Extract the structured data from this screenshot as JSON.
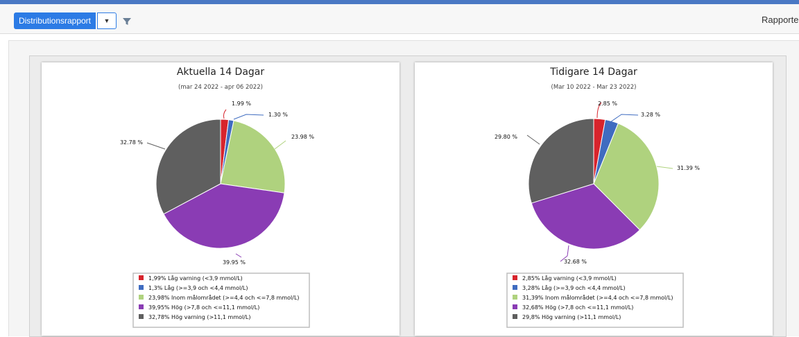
{
  "toolbar": {
    "report_button_label": "Distributionsrapport",
    "caret_icon": "caret-down-icon",
    "filter_icon": "filter-icon",
    "right_label": "Rapporter"
  },
  "colors": {
    "lag_varning": "#d7242c",
    "lag": "#3f6cc0",
    "inom": "#afd27e",
    "hog": "#8a3cb4",
    "hog_varning": "#5f5f5f",
    "toolbar_button": "#2c7be5"
  },
  "chart_data": [
    {
      "type": "pie",
      "title": "Aktuella 14 Dagar",
      "subtitle": "(mar 24 2022 - apr 06 2022)",
      "slices": [
        {
          "value": 1.99,
          "label": "1.99 %",
          "legend": "1,99% Låg varning (<3,9 mmol/L)",
          "color": "#d7242c"
        },
        {
          "value": 1.3,
          "label": "1.30 %",
          "legend": "1,3% Låg (>=3,9 och <4,4 mmol/L)",
          "color": "#3f6cc0"
        },
        {
          "value": 23.98,
          "label": "23.98 %",
          "legend": "23,98% Inom målområdet (>=4,4 och <=7,8 mmol/L)",
          "color": "#afd27e"
        },
        {
          "value": 39.95,
          "label": "39.95 %",
          "legend": "39,95% Hög (>7,8 och <=11,1 mmol/L)",
          "color": "#8a3cb4"
        },
        {
          "value": 32.78,
          "label": "32.78 %",
          "legend": "32,78% Hög varning (>11,1 mmol/L)",
          "color": "#5f5f5f"
        }
      ]
    },
    {
      "type": "pie",
      "title": "Tidigare 14 Dagar",
      "subtitle": "(Mar 10 2022 - Mar 23 2022)",
      "slices": [
        {
          "value": 2.85,
          "label": "2.85 %",
          "legend": "2,85% Låg varning (<3,9 mmol/L)",
          "color": "#d7242c"
        },
        {
          "value": 3.28,
          "label": "3.28 %",
          "legend": "3,28% Låg (>=3,9 och <4,4 mmol/L)",
          "color": "#3f6cc0"
        },
        {
          "value": 31.39,
          "label": "31.39 %",
          "legend": "31,39% Inom målområdet (>=4,4 och <=7,8 mmol/L)",
          "color": "#afd27e"
        },
        {
          "value": 32.68,
          "label": "32.68 %",
          "legend": "32,68% Hög (>7,8 och <=11,1 mmol/L)",
          "color": "#8a3cb4"
        },
        {
          "value": 29.8,
          "label": "29.80 %",
          "legend": "29,8% Hög varning (>11,1 mmol/L)",
          "color": "#5f5f5f"
        }
      ]
    }
  ]
}
